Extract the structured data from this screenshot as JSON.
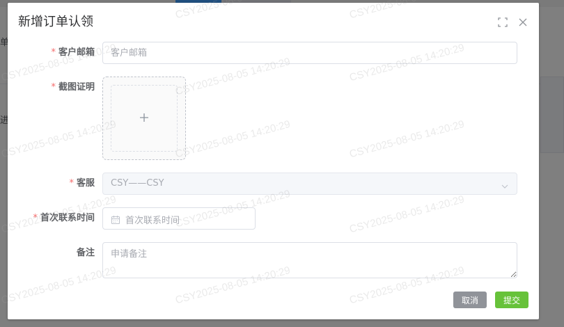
{
  "background": {
    "left_text_1": "单",
    "left_text_2": "进"
  },
  "dialog": {
    "title": "新增订单认领",
    "fullscreen_icon": "fullscreen-icon",
    "close_icon": "close-icon"
  },
  "form": {
    "required_mark": "*",
    "email": {
      "label": "客户邮箱",
      "placeholder": "客户邮箱",
      "value": ""
    },
    "screenshot": {
      "label": "截图证明",
      "icon": "plus-icon"
    },
    "service": {
      "label": "客服",
      "value": "CSY——CSY",
      "icon": "chevron-down-icon"
    },
    "first_contact": {
      "label": "首次联系时间",
      "placeholder": "首次联系时间",
      "icon": "calendar-icon"
    },
    "remark": {
      "label": "备注",
      "placeholder": "申请备注",
      "value": ""
    }
  },
  "footer": {
    "cancel_label": "取消",
    "submit_label": "提交"
  },
  "watermark": {
    "text": "CSY2025-08-05 14:20:29"
  },
  "colors": {
    "required": "#f56c6c",
    "submit": "#67c23a",
    "cancel": "#909399",
    "accent": "#409eff"
  }
}
